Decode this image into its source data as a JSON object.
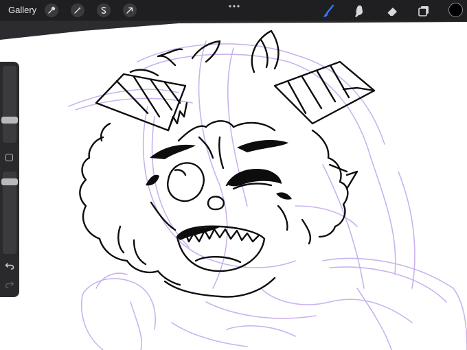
{
  "toolbar": {
    "gallery_label": "Gallery",
    "left_tools": [
      "wrench-icon",
      "magic-wand-icon",
      "selection-icon",
      "transform-arrow-icon"
    ],
    "right_tools": [
      "brush-icon",
      "smudge-icon",
      "eraser-icon",
      "layers-icon"
    ],
    "active_tool": "brush-icon",
    "accent_color": "#2f7bff",
    "current_color": "#000000"
  },
  "sidebar": {
    "brush_size_level": 0.25,
    "opacity_level": 0.95,
    "controls": [
      "modify-button",
      "undo-icon",
      "redo-icon"
    ]
  },
  "canvas": {
    "sketch_color": "#c9b3ee",
    "ink_color": "#0d0d0d",
    "background": "#ffffff"
  }
}
